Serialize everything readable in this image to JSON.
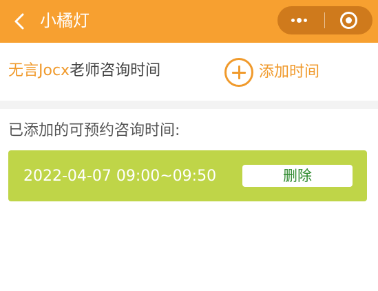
{
  "nav": {
    "title": "小橘灯",
    "back_icon": "chevron-left-icon",
    "more_icon": "more-dots-icon",
    "close_icon": "target-close-icon"
  },
  "header": {
    "teacher_name": "无言Jocx",
    "title_suffix": "老师咨询时间",
    "add_label": "添加时间",
    "add_icon": "plus-circle-icon"
  },
  "slots": {
    "section_title": "已添加的可预约咨询时间:",
    "items": [
      {
        "time": "2022-04-07 09:00~09:50",
        "delete_label": "删除"
      }
    ]
  },
  "colors": {
    "nav_bg": "#f7a030",
    "accent": "#f09a2c",
    "slot_bg": "#bfd548",
    "delete_text": "#2f8a2f"
  }
}
